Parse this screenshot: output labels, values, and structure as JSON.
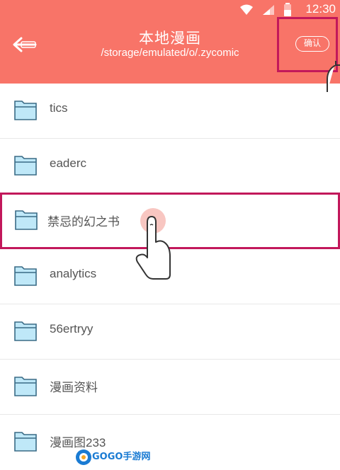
{
  "status_bar": {
    "time": "12:30"
  },
  "header": {
    "title": "本地漫画",
    "path": "/storage/emulated/o/.zycomic",
    "confirm_label": "确认"
  },
  "folders": [
    {
      "name": "tics"
    },
    {
      "name": "eaderc"
    },
    {
      "name": "禁忌的幻之书"
    },
    {
      "name": "analytics"
    },
    {
      "name": "56ertryy"
    },
    {
      "name": "漫画资料"
    },
    {
      "name": "漫画图233"
    }
  ],
  "watermark": {
    "text": "GOGO手游网"
  },
  "colors": {
    "appbar": "#f87468",
    "folder_fill": "#bfe8f8",
    "folder_stroke": "#3a6b86",
    "highlight": "#c2185b"
  }
}
